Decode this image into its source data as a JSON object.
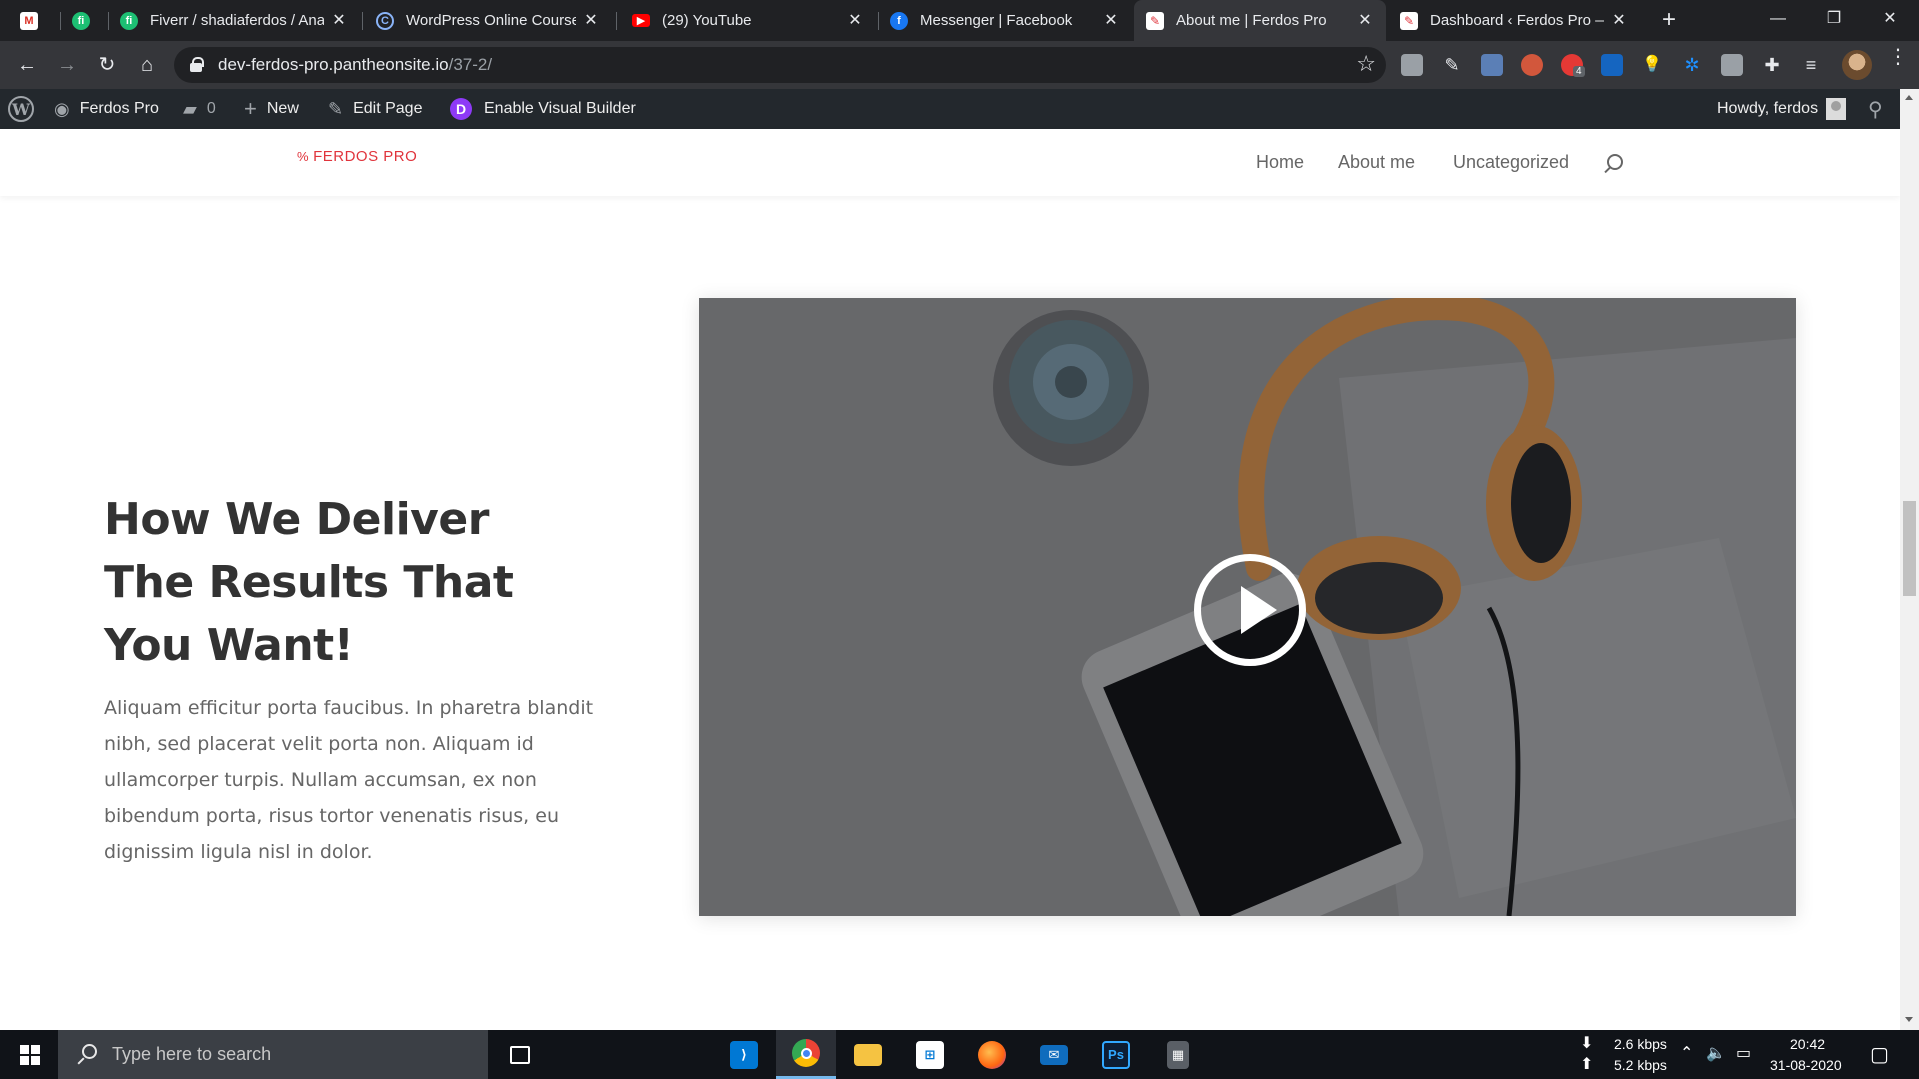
{
  "browser": {
    "tabs": [
      {
        "title": "",
        "favicon": "gmail-icon"
      },
      {
        "title": "",
        "favicon": "fiverr-icon"
      },
      {
        "title": "Fiverr / shadiaferdos / Ana",
        "favicon": "fiverr-icon"
      },
      {
        "title": "WordPress Online Course",
        "favicon": "course-icon"
      },
      {
        "title": "(29) YouTube",
        "favicon": "youtube-icon"
      },
      {
        "title": "Messenger | Facebook",
        "favicon": "facebook-icon"
      },
      {
        "title": "About me | Ferdos Pro",
        "favicon": "wordpress-site-icon"
      },
      {
        "title": "Dashboard ‹ Ferdos Pro —",
        "favicon": "wordpress-site-icon"
      }
    ],
    "active_tab_index": 6,
    "url_host": "dev-ferdos-pro.pantheonsite.io",
    "url_path": "/37-2/",
    "extension_badge": "4"
  },
  "wp_admin_bar": {
    "site_name": "Ferdos Pro",
    "comments_count": "0",
    "new_label": "New",
    "edit_label": "Edit Page",
    "builder_letter": "D",
    "builder_label": "Enable Visual Builder",
    "howdy": "Howdy, ferdos"
  },
  "site": {
    "logo_text": "FERDOS PRO",
    "menu": [
      "Home",
      "About me",
      "Uncategorized"
    ]
  },
  "content": {
    "heading": "How We Deliver The Results That You Want!",
    "body": "Aliquam efficitur porta faucibus. In pharetra blandit nibh, sed placerat velit porta non. Aliquam id ullamcorper turpis. Nullam accumsan, ex non bibendum porta, risus tortor venenatis risus, eu dignissim ligula nisl in dolor."
  },
  "taskbar": {
    "search_placeholder": "Type here to search",
    "download_speed": "2.6 kbps",
    "upload_speed": "5.2 kbps",
    "time": "20:42",
    "date": "31-08-2020"
  },
  "colors": {
    "accent": "#e0343c",
    "wp_bar": "#23282d",
    "divi_purple": "#8e3af7"
  }
}
